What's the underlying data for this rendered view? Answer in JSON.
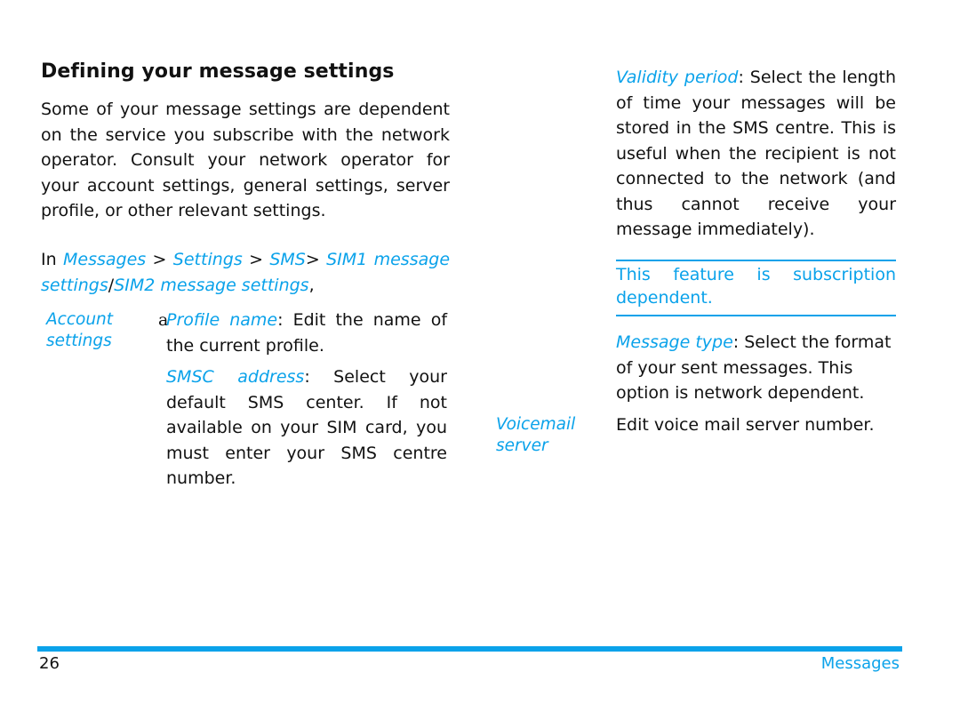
{
  "heading": "Defining your message settings",
  "intro": "Some of your message settings are dependent on the service you subscribe with the network operator. Consult your network operator for your account settings, general settings, server profile, or other relevant settings.",
  "path": {
    "prefix": "In ",
    "messages": "Messages",
    "sep1": " > ",
    "settings": "Settings",
    "sep2": " > ",
    "sms": "SMS",
    "sep3": "> ",
    "sim1": "SIM1 message settings",
    "slash": "/",
    "sim2": "SIM2 message settings",
    "suffix": ","
  },
  "account_settings": {
    "label_line1": "Account",
    "label_line2": "settings",
    "bullet": "a",
    "items": [
      {
        "term": "Profile name",
        "desc": ": Edit the name of the current profile."
      },
      {
        "term": "SMSC address",
        "desc": ": Select your default SMS center. If not available on your SIM card, you must enter your SMS centre number."
      }
    ]
  },
  "right_column": {
    "validity": {
      "term": "Validity period",
      "desc": ": Select the length of time your messages will be stored in the SMS centre. This is useful when the recipient is not connected to the network (and thus cannot receive your message immediately)."
    },
    "note": "This feature is subscription dependent.",
    "message_type": {
      "term": "Message type",
      "desc": ": Select the format of your sent messages. This option is network dependent."
    },
    "voicemail": {
      "label_line1": "Voicemail",
      "label_line2": "server",
      "desc": "Edit voice mail server number."
    }
  },
  "footer": {
    "page_number": "26",
    "section": "Messages"
  },
  "colors": {
    "accent": "#0aa2ea",
    "text": "#111111"
  }
}
